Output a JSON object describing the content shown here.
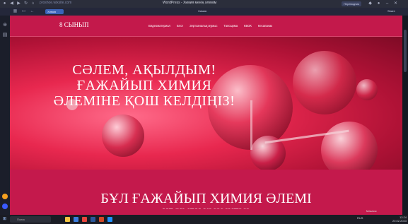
{
  "browser": {
    "url": "proshoe.wixsite.com",
    "tab_title": "WordPress - Химия менің әлемім",
    "translate_label": "Переводчик",
    "pill_label": "Химия",
    "mid_label": "Химия",
    "right_label": "Share"
  },
  "site": {
    "brand": "8 СЫНЫП",
    "nav": [
      "Видеоматериал",
      "Блог",
      "Зертханалық жұмыс",
      "Тапсырма",
      "КБОК",
      "Кесапанак"
    ],
    "hero_title": "СӘЛЕМ, АҚЫЛДЫМ! ҒАЖАЙЫП ХИМИЯ ӘЛЕМІНЕ ҚОШ КЕЛДІҢІЗ!",
    "section2_title": "БҰЛ ҒАЖАЙЫП ХИМИЯ ӘЛЕМІ",
    "section2_sub": "НЕСІМЕН ҚЫЗЫҚТЫ?"
  },
  "taskbar": {
    "search_placeholder": "Поиск",
    "tray": "RUS",
    "time": "12:24",
    "date": "20.02.2023",
    "weather": "Мазасы"
  },
  "colors": {
    "accent": "#c3194b",
    "hero_dark": "#7e0a25",
    "hero_light": "#ff6b8a"
  }
}
